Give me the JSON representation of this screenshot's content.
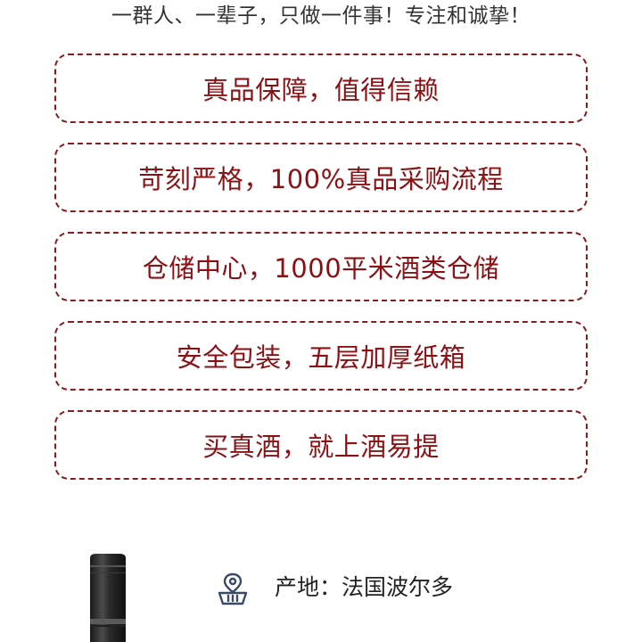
{
  "tagline": "一群人、一辈子，只做一件事！专注和诚挚！",
  "promises": [
    "真品保障，值得信赖",
    "苛刻严格，100%真品采购流程",
    "仓储中心，1000平米酒类仓储",
    "安全包装，五层加厚纸箱",
    "买真酒，就上酒易提"
  ],
  "product": {
    "origin": "产地：法国波尔多",
    "origin_icon": "location-basket-icon"
  },
  "colors": {
    "accent": "#8b1014",
    "border": "#8b1a1f",
    "icon": "#3a4a66"
  }
}
